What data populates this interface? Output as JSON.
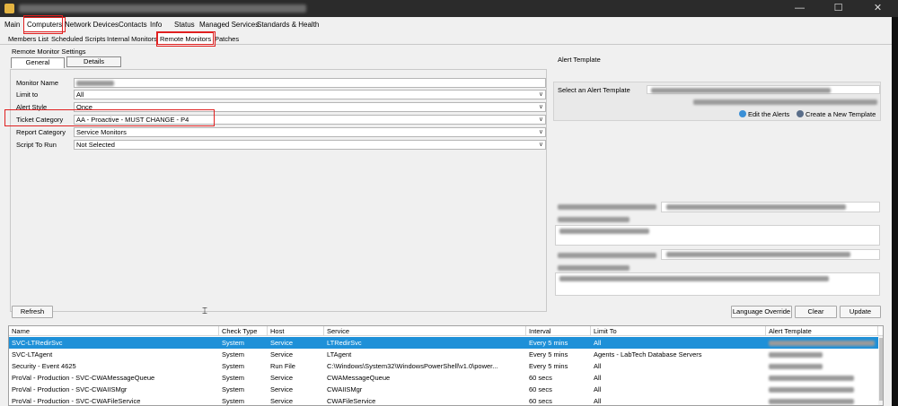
{
  "colors": {
    "accent": "#1e90d8",
    "highlight": "#e02020"
  },
  "window": {
    "minimize": "—",
    "maximize": "☐",
    "close": "✕"
  },
  "menu": {
    "items": [
      "Main",
      "Computers",
      "Network Devices",
      "Contacts",
      "Info",
      "Status",
      "Managed Services",
      "Standards & Health"
    ],
    "active": "Computers"
  },
  "subtabs": {
    "items": [
      "Members List",
      "Scheduled Scripts",
      "Internal Monitors",
      "Remote Monitors",
      "Patches"
    ],
    "active": "Remote Monitors"
  },
  "settings": {
    "title": "Remote Monitor Settings",
    "tabs": [
      "General",
      "Details"
    ],
    "fields": [
      {
        "label": "Monitor Name",
        "value": ""
      },
      {
        "label": "Limit to",
        "value": "All"
      },
      {
        "label": "Alert Style",
        "value": "Once"
      },
      {
        "label": "Ticket Category",
        "value": "AA - Proactive - MUST CHANGE - P4"
      },
      {
        "label": "Report Category",
        "value": "Service Monitors"
      },
      {
        "label": "Script To Run",
        "value": "Not Selected"
      }
    ]
  },
  "alert_template": {
    "title": "Alert Template",
    "select_label": "Select an Alert Template",
    "edit_link": "Edit the Alerts",
    "create_link": "Create a New Template"
  },
  "buttons": {
    "refresh": "Refresh",
    "language_override": "Language Override",
    "clear": "Clear",
    "update": "Update"
  },
  "table": {
    "columns": [
      "Name",
      "Check Type",
      "Host",
      "Service",
      "Interval",
      "Limit To",
      "Alert Template"
    ],
    "rows": [
      [
        "SVC-LTRedirSvc",
        "System",
        "Service",
        "LTRedirSvc",
        "Every 5 mins",
        "All",
        ""
      ],
      [
        "SVC-LTAgent",
        "System",
        "Service",
        "LTAgent",
        "Every 5 mins",
        "Agents - LabTech Database Servers",
        ""
      ],
      [
        "Security - Event 4625",
        "System",
        "Run File",
        "C:\\Windows\\System32\\WindowsPowerShell\\v1.0\\power...",
        "Every 5 mins",
        "All",
        ""
      ],
      [
        "ProVal - Production - SVC-CWAMessageQueue",
        "System",
        "Service",
        "CWAMessageQueue",
        "60 secs",
        "All",
        ""
      ],
      [
        "ProVal - Production - SVC-CWAIISMgr",
        "System",
        "Service",
        "CWAIISMgr",
        "60 secs",
        "All",
        ""
      ],
      [
        "ProVal - Production - SVC-CWAFileService",
        "System",
        "Service",
        "CWAFileService",
        "60 secs",
        "All",
        ""
      ]
    ],
    "selected_row": 0
  }
}
